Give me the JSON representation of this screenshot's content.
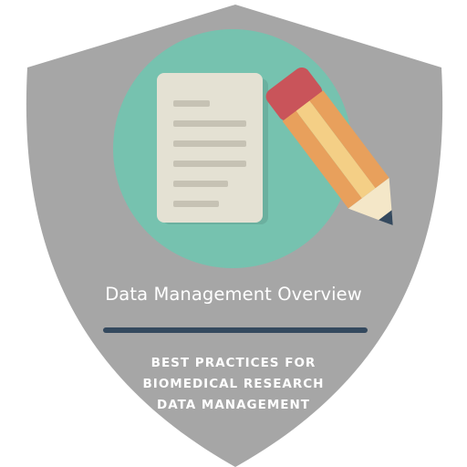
{
  "badge": {
    "title": "Data Management Overview",
    "subtitle_lines": [
      "BEST PRACTICES FOR",
      "BIOMEDICAL RESEARCH",
      "DATA MANAGEMENT"
    ],
    "icon": "document-with-pencil-icon",
    "colors": {
      "shield": "#a6a6a6",
      "circle": "#76c2af",
      "divider": "#34495e",
      "text": "#ffffff"
    }
  }
}
